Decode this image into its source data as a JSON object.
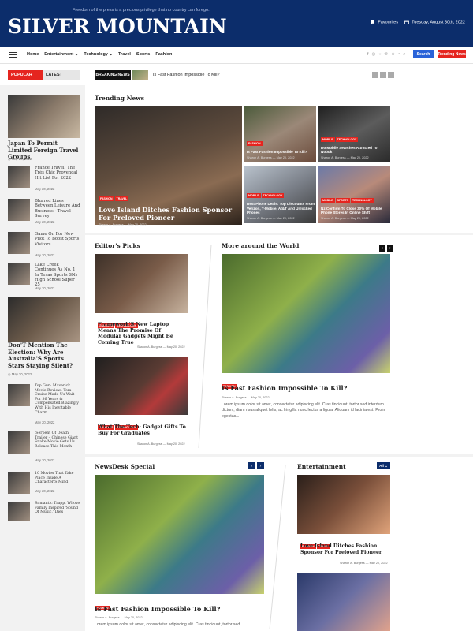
{
  "header": {
    "tagline": "Freedom of the press is a precious privilege that no country can forego.",
    "logo": "SILVER MOUNTAIN",
    "favourites": "Favourites",
    "date": "Tuesday, August 30th, 2022"
  },
  "nav": {
    "items": [
      "Home",
      "Entertainment ⌄",
      "Technology ⌄",
      "Travel",
      "Sports",
      "Fashion"
    ],
    "social_icons": [
      "facebook-icon",
      "twitter-icon",
      "instagram-icon",
      "pinterest-icon",
      "snapchat-icon",
      "vk-icon",
      "search-icon"
    ],
    "search_label": "Search",
    "trending_label": "Trending News"
  },
  "tabs": {
    "popular": "POPULAR",
    "latest": "LATEST"
  },
  "breaking": {
    "label": "BREAKING NEWS",
    "text": "Is Fast Fashion Impossible To Kill?"
  },
  "sidebar": {
    "hero1": {
      "title": "Japan To Permit Limited Foreign Travel Groups",
      "date": "May 20, 2022"
    },
    "items": [
      {
        "title": "France Travel: The Trés Chic Provençal Hit List For 2022",
        "date": "May 20, 2022"
      },
      {
        "title": "Blurred Lines Between Leisure And Business · Travel Survey",
        "date": "May 20, 2022"
      },
      {
        "title": "Game On For New Pilot To Boost Sports Visitors",
        "date": "May 20, 2022"
      },
      {
        "title": "Lake Creek Continues As No. 1 In Texas Sports SNs High School Super 25",
        "date": "May 20, 2022"
      }
    ],
    "hero2": {
      "title": "Don'T Mention The Election: Why Are Australia'S Sports Stars Staying Silent?",
      "date": "May 20, 2022"
    },
    "items2": [
      {
        "title": "Top Gun: Maverick Movie Review: Tom Cruise Made Us Wait For 36 Years & Compensated Blazingly With His Inevitable Charm",
        "date": "May 20, 2022"
      },
      {
        "title": "'Serpent Of Death' Trailer – Chinese Giant Snake Movie Gets Us Release This Month",
        "date": "May 20, 2022"
      },
      {
        "title": "10 Movies That Take Place Inside A Character'S Mind",
        "date": "May 20, 2022"
      },
      {
        "title": "Romantic Trapp, Whose Family Inspired 'Sound Of Music,' Dies",
        "date": "May 20, 2022"
      }
    ]
  },
  "trending": {
    "title": "Trending News",
    "big": {
      "tags": [
        "FASHION",
        "TRAVEL"
      ],
      "title": "Love Island Ditches Fashion Sponsor For Preloved Pioneer",
      "author": "Sharon A. Burgess",
      "date": "May 20, 2022"
    },
    "small": [
      {
        "tags": [
          "FASHION"
        ],
        "title": "Is Fast Fashion Impossible To Kill?",
        "author": "Sharon A. Burgess",
        "date": "May 20, 2022"
      },
      {
        "tags": [
          "MOBILE",
          "TECHNOLOGY"
        ],
        "title": "Do Mobile Searches Attracted To Nobuk",
        "author": "Sharon A. Burgess",
        "date": "May 20, 2022"
      },
      {
        "tags": [
          "MOBILE",
          "TECHNOLOGY"
        ],
        "title": "Best Phone Deals: Top Discounts From Verizon, T-Mobile, At&T And Unlocked Phones",
        "author": "Sharon A. Burgess",
        "date": "May 20, 2022"
      },
      {
        "tags": [
          "MOBILE",
          "SPORTS",
          "TECHNOLOGY"
        ],
        "title": "Nz Confirm To Close 30% Of Mobile Phone Stores In Online Shift",
        "author": "Sharon A. Burgess",
        "date": "May 20, 2022"
      }
    ]
  },
  "editors": {
    "title": "Editor's Picks",
    "items": [
      {
        "tags": [
          "GADGETS",
          "TECHNOLOGY"
        ],
        "title": "Framework'S New Laptop Means The Promise Of Modular Gadgets Might Be Coming True",
        "author": "Sharon A. Burgess",
        "date": "May 20, 2022"
      },
      {
        "tags": [
          "GADGETS",
          "TECHNOLOGY"
        ],
        "title": "What The Tech: Gadget Gifts To Buy For Graduates",
        "author": "Sharon A. Burgess",
        "date": "May 20, 2022"
      }
    ]
  },
  "world": {
    "title": "More around the World",
    "tag": "FASHION",
    "headline": "Is Fast Fashion Impossible To Kill?",
    "author": "Sharon A. Burgess",
    "date": "May 20, 2022",
    "excerpt": "Lorem ipsum dolor sit amet, consectetur adipiscing elit. Cras tincidunt, tortor sed interdum dictum, diam risus aliquet felis, ac fringilla nunc lectus a ligula. Aliquam id lacinia est. Proin egestas..."
  },
  "newsdesk": {
    "title": "NewsDesk Special",
    "tag": "FASHION",
    "headline": "Is Fast Fashion Impossible To Kill?",
    "author": "Sharon A. Burgess",
    "date": "May 20, 2022",
    "excerpt": "Lorem ipsum dolor sit amet, consectetur adipiscing elit. Cras tincidunt, tortor sed"
  },
  "entertainment": {
    "title": "Entertainment",
    "all_label": "All",
    "item": {
      "tags": [
        "FASHION",
        "TRAVEL"
      ],
      "title": "Love Island Ditches Fashion Sponsor For Preloved Pioneer",
      "author": "Sharon A. Burgess",
      "date": "May 20, 2022"
    }
  },
  "colors": {
    "brand": "#0c2d6b",
    "accent": "#e5251f",
    "search": "#2a63d8"
  }
}
